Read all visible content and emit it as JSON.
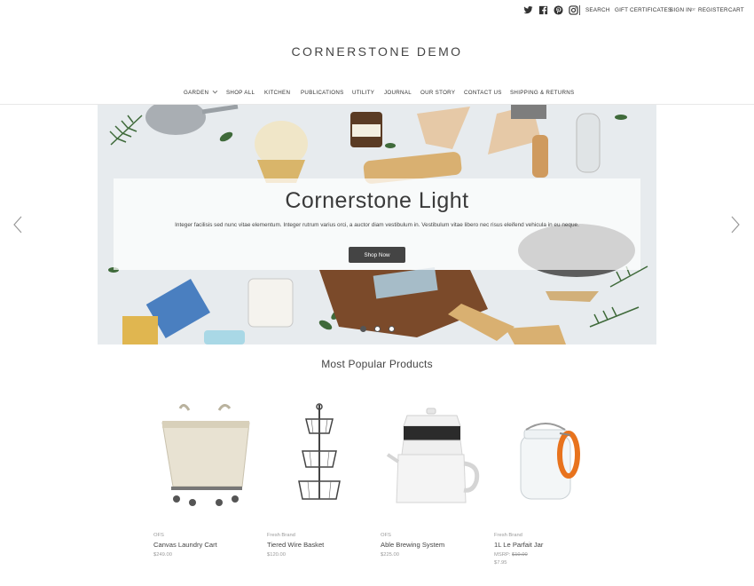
{
  "header": {
    "social_icons": [
      "twitter-icon",
      "facebook-icon",
      "pinterest-icon",
      "instagram-icon"
    ],
    "links": {
      "search": "Search",
      "gift_certificates": "Gift Certificates",
      "sign_in": "Sign in",
      "or": "or",
      "register": "Register",
      "cart": "Cart"
    },
    "logo": "CORNERSTONE DEMO"
  },
  "nav": {
    "items": [
      "Garden",
      "Shop All",
      "Kitchen",
      "Publications",
      "Utility",
      "Journal",
      "Our Story",
      "Contact Us",
      "Shipping & Returns"
    ]
  },
  "hero": {
    "title": "Cornerstone Light",
    "description": "Integer facilisis sed nunc vitae elementum. Integer rutrum varius orci, a auctor diam vestibulum in. Vestibulum vitae libero nec risus eleifend vehicula in eu neque.",
    "button": "Shop Now",
    "slides": 3,
    "active_slide": 1
  },
  "products": {
    "title": "Most Popular Products",
    "items": [
      {
        "brand": "OFS",
        "name": "Canvas Laundry Cart",
        "price": "$249.00"
      },
      {
        "brand": "Fresh Brand",
        "name": "Tiered Wire Basket",
        "price": "$120.00"
      },
      {
        "brand": "OFS",
        "name": "Able Brewing System",
        "price": "$225.00"
      },
      {
        "brand": "Fresh Brand",
        "name": "1L Le Parfait Jar",
        "msrp_label": "MSRP:",
        "msrp": "$10.00",
        "price": "$7.95"
      }
    ]
  },
  "colors": {
    "text": "#333333",
    "button": "#444444",
    "muted": "#999999"
  }
}
